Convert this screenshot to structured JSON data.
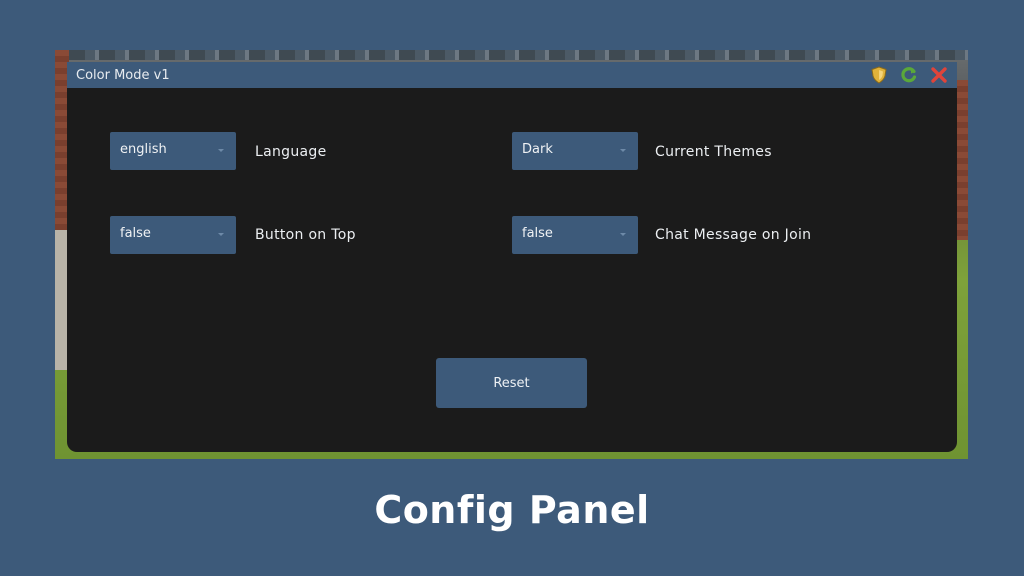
{
  "window": {
    "title": "Color Mode v1"
  },
  "titlebar_icons": [
    {
      "name": "shield-icon",
      "color": "#e0b23a"
    },
    {
      "name": "refresh-icon",
      "color": "#5aa83a"
    },
    {
      "name": "close-icon",
      "color": "#e0443a"
    }
  ],
  "settings": {
    "language": {
      "value": "english",
      "label": "Language"
    },
    "theme": {
      "value": "Dark",
      "label": "Current Themes"
    },
    "button_on_top": {
      "value": "false",
      "label": "Button on Top"
    },
    "chat_message_on_join": {
      "value": "false",
      "label": "Chat Message on Join"
    }
  },
  "reset_label": "Reset",
  "caption": "Config Panel",
  "colors": {
    "accent": "#3d5a7a",
    "panel": "#1b1b1b"
  }
}
